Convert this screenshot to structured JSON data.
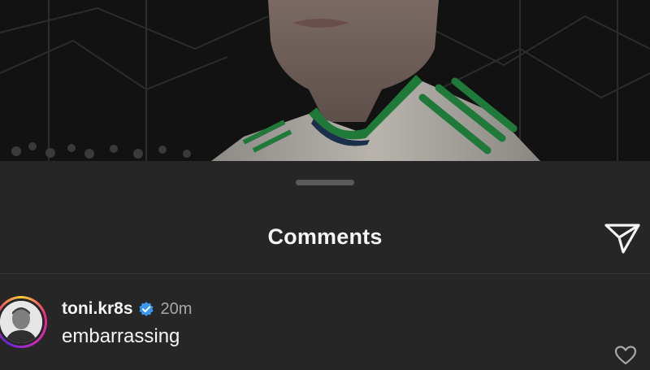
{
  "post": {
    "photo_icon": "player-photo"
  },
  "sheet": {
    "title": "Comments",
    "share_icon": "send-icon"
  },
  "comments": [
    {
      "username": "toni.kr8s",
      "verified": true,
      "time": "20m",
      "text": "embarrassing",
      "like_icon": "heart-outline-icon"
    }
  ],
  "colors": {
    "background": "#262626",
    "text_primary": "#f5f5f5",
    "text_secondary": "#a8a8a8",
    "verified_blue": "#3897f0",
    "jersey_green": "#1f7a3a"
  }
}
